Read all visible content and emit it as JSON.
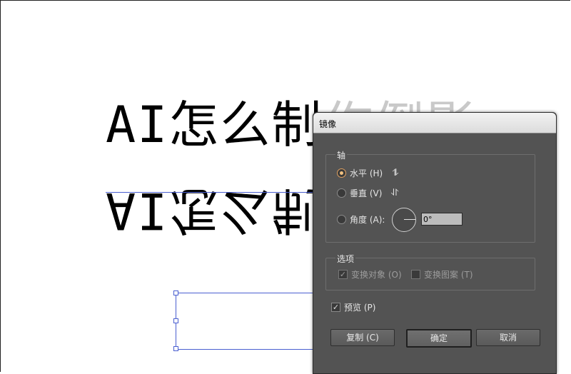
{
  "artwork": {
    "text_visible": "AI怎么制",
    "text_ghost": "作倒影",
    "text_mirrored": "AI怎么制"
  },
  "dialog": {
    "title": "镜像",
    "axis_group_label": "轴",
    "horizontal_label": "水平 (H)",
    "vertical_label": "垂直 (V)",
    "angle_label": "角度 (A):",
    "angle_value": "0°",
    "selected_axis": "horizontal",
    "options_group_label": "选项",
    "transform_objects_label": "变换对象 (O)",
    "transform_patterns_label": "变换图案 (T)",
    "preview_label": "预览 (P)",
    "copy_button": "复制 (C)",
    "ok_button": "确定",
    "cancel_button": "取消"
  },
  "colors": {
    "dialog_bg": "#535353",
    "selection": "#4a5fd0",
    "radio_selected": "#f0c080"
  }
}
